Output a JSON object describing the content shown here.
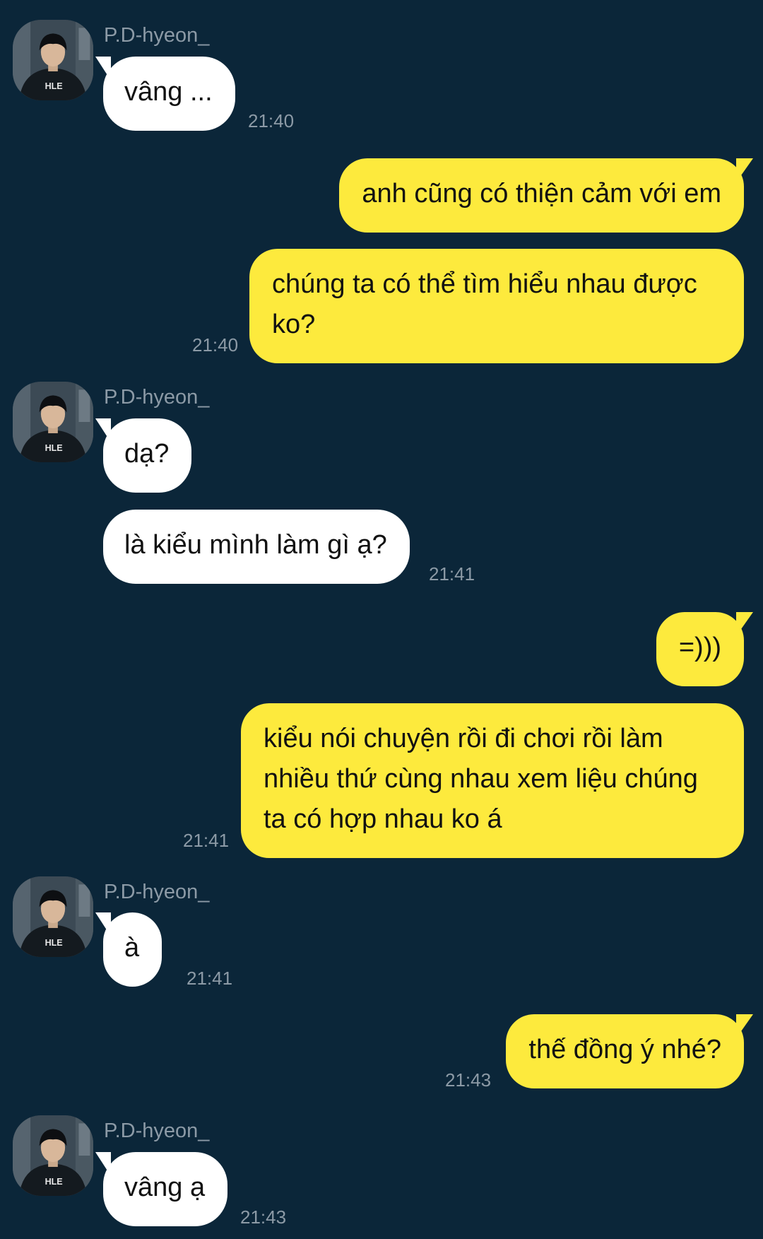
{
  "contact": {
    "name": "P.D-hyeon_",
    "avatar_shirt_text": "HLE"
  },
  "messages": [
    {
      "from": "them",
      "text": "vâng ...",
      "time": "21:40"
    },
    {
      "from": "me",
      "text": "anh cũng có thiện cảm với em",
      "time": ""
    },
    {
      "from": "me",
      "text": "chúng ta có thể tìm hiểu nhau được ko?",
      "time": "21:40"
    },
    {
      "from": "them",
      "text": "dạ?",
      "time": ""
    },
    {
      "from": "them",
      "text": "là kiểu mình làm gì ạ?",
      "time": "21:41"
    },
    {
      "from": "me",
      "text": "=)))",
      "time": ""
    },
    {
      "from": "me",
      "text": "kiểu nói chuyện rồi đi chơi rồi làm nhiều thứ cùng nhau xem liệu chúng ta có hợp nhau ko á",
      "time": "21:41"
    },
    {
      "from": "them",
      "text": "à",
      "time": "21:41"
    },
    {
      "from": "me",
      "text": "thế đồng ý nhé?",
      "time": "21:43"
    },
    {
      "from": "them",
      "text": "vâng ạ",
      "time": "21:43"
    }
  ],
  "colors": {
    "background": "#0b2639",
    "outgoing_bubble": "#fdea3d",
    "incoming_bubble": "#ffffff",
    "meta_text": "#8c9aa6"
  }
}
